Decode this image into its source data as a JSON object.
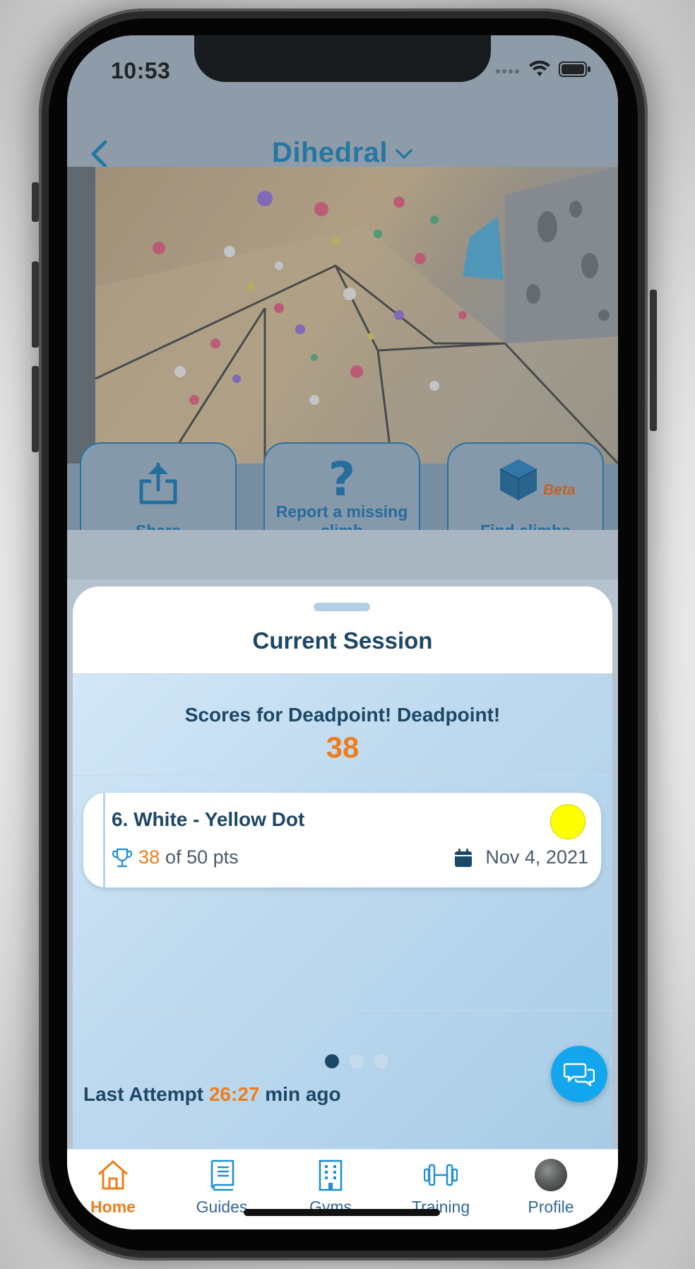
{
  "status_bar": {
    "time": "10:53"
  },
  "nav": {
    "title": "Dihedral"
  },
  "actions": [
    {
      "label": "Share",
      "icon": "share-icon"
    },
    {
      "label": "Report a missing climb",
      "icon": "question-icon"
    },
    {
      "label": "Find climbs",
      "icon": "cube-icon",
      "badge": "Beta"
    }
  ],
  "session": {
    "title": "Current Session",
    "scores_label": "Scores for Deadpoint! Deadpoint!",
    "score": "38",
    "climb": {
      "name": "6. White - Yellow Dot",
      "points": "38",
      "points_suffix": "of 50 pts",
      "date": "Nov 4, 2021",
      "hold_color": "#ffff00"
    },
    "pager": {
      "count": 3,
      "active": 0
    },
    "last_attempt_prefix": "Last Attempt",
    "last_attempt_time": "26:27",
    "last_attempt_suffix": "min ago"
  },
  "tabs": [
    {
      "label": "Home",
      "active": true
    },
    {
      "label": "Guides"
    },
    {
      "label": "Gyms"
    },
    {
      "label": "Training"
    },
    {
      "label": "Profile"
    }
  ],
  "colors": {
    "brand": "#1874a8",
    "accent": "#ef7d1b",
    "dark": "#1d4766",
    "fab": "#13a6ee"
  }
}
